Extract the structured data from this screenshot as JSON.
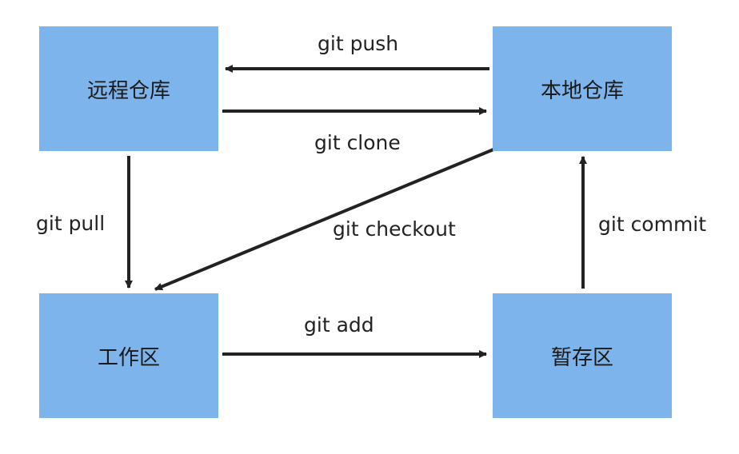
{
  "nodes": {
    "remote_repo": "远程仓库",
    "local_repo": "本地仓库",
    "working_dir": "工作区",
    "staging_area": "暂存区"
  },
  "edges": {
    "push": "git push",
    "clone": "git clone",
    "pull": "git pull",
    "checkout": "git checkout",
    "commit": "git commit",
    "add": "git add"
  },
  "colors": {
    "box_fill": "#7eb4ec",
    "arrow": "#222222"
  }
}
